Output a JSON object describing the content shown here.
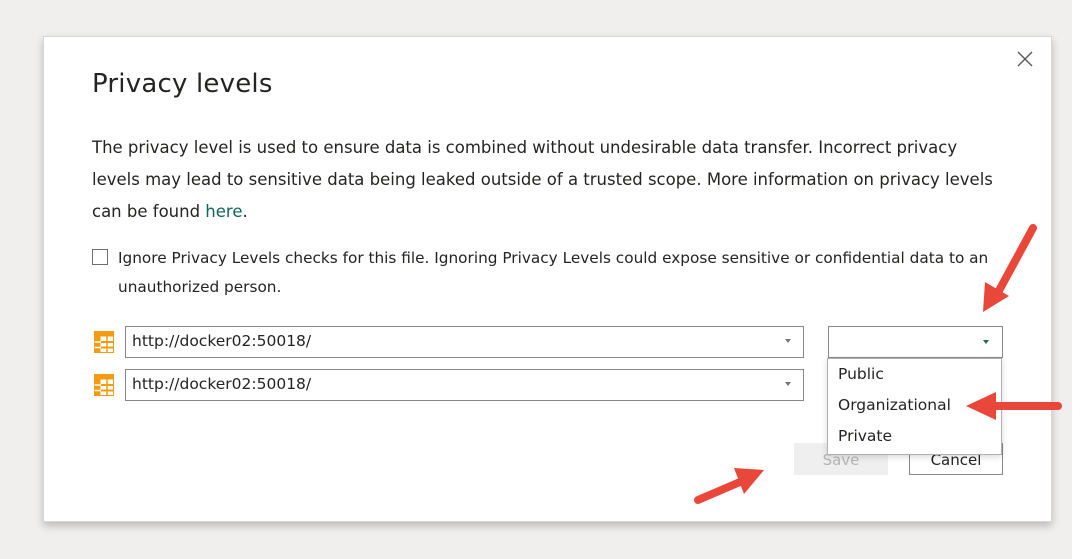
{
  "dialog": {
    "title": "Privacy levels",
    "description": "The privacy level is used to ensure data is combined without undesirable data transfer. Incorrect privacy levels may lead to sensitive data being leaked outside of a trusted scope. More information on privacy levels can be found ",
    "link_text": "here",
    "link_suffix": ".",
    "ignore_checkbox_label": "Ignore Privacy Levels checks for this file. Ignoring Privacy Levels could expose sensitive or confidential data to an unauthorized person.",
    "ignore_checked": false,
    "sources": [
      {
        "url": "http://docker02:50018/",
        "icon": "table-icon"
      },
      {
        "url": "http://docker02:50018/",
        "icon": "table-icon"
      }
    ],
    "privacy_level_selected": "",
    "privacy_level_options": [
      "Public",
      "Organizational",
      "Private"
    ],
    "save_label": "Save",
    "cancel_label": "Cancel",
    "close_icon": "close-icon"
  },
  "colors": {
    "link": "#11645f",
    "accent_green": "#1e7145",
    "table_icon": "#f39c12",
    "annotation_arrow": "#e8473a"
  }
}
